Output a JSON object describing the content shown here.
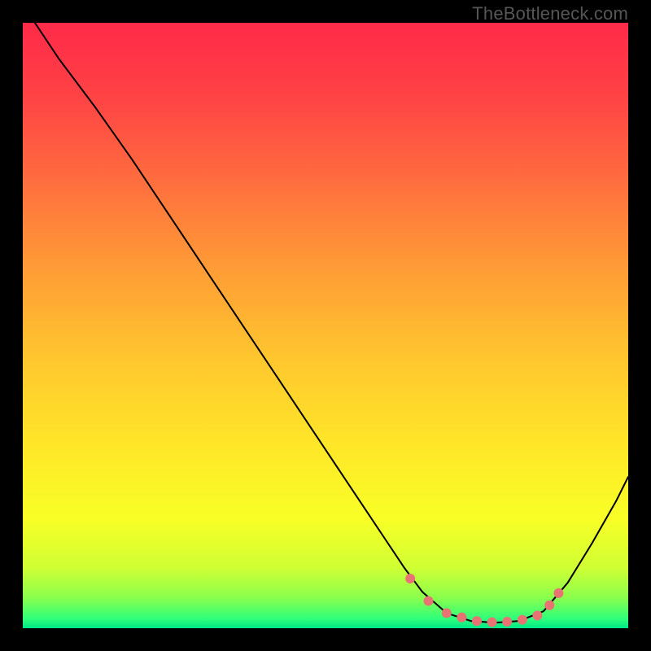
{
  "watermark": "TheBottleneck.com",
  "chart_data": {
    "type": "line",
    "title": "",
    "xlabel": "",
    "ylabel": "",
    "xlim": [
      0,
      100
    ],
    "ylim": [
      0,
      100
    ],
    "grid": false,
    "series": [
      {
        "name": "curve",
        "color": "#000000",
        "stroke_width": 2,
        "x": [
          2,
          6,
          12,
          18,
          24,
          30,
          36,
          42,
          48,
          54,
          60,
          63,
          66,
          70,
          74,
          78,
          82,
          86,
          90,
          94,
          98,
          100
        ],
        "y": [
          100,
          94,
          86,
          77.5,
          68.5,
          59.5,
          50.5,
          41.5,
          32.5,
          23.5,
          14.5,
          10,
          6,
          2.5,
          1.2,
          0.9,
          1.2,
          2.8,
          7.5,
          14,
          21,
          25
        ]
      },
      {
        "name": "markers",
        "color": "#e77373",
        "marker_radius": 6,
        "x": [
          64,
          67,
          70,
          72.5,
          75,
          77.5,
          80,
          82.5,
          85,
          87,
          88.5
        ],
        "y": [
          8.2,
          4.5,
          2.5,
          1.8,
          1.2,
          1.0,
          1.1,
          1.4,
          2.1,
          3.8,
          5.8
        ]
      }
    ],
    "gradient_stops": [
      {
        "offset": 0.0,
        "color": "#ff2a49"
      },
      {
        "offset": 0.12,
        "color": "#ff4245"
      },
      {
        "offset": 0.25,
        "color": "#ff6a3f"
      },
      {
        "offset": 0.4,
        "color": "#ff9a36"
      },
      {
        "offset": 0.55,
        "color": "#ffc52e"
      },
      {
        "offset": 0.7,
        "color": "#ffe728"
      },
      {
        "offset": 0.82,
        "color": "#f8ff26"
      },
      {
        "offset": 0.9,
        "color": "#d0ff33"
      },
      {
        "offset": 0.95,
        "color": "#8aff4d"
      },
      {
        "offset": 0.985,
        "color": "#2cff7b"
      },
      {
        "offset": 1.0,
        "color": "#00e887"
      }
    ]
  }
}
